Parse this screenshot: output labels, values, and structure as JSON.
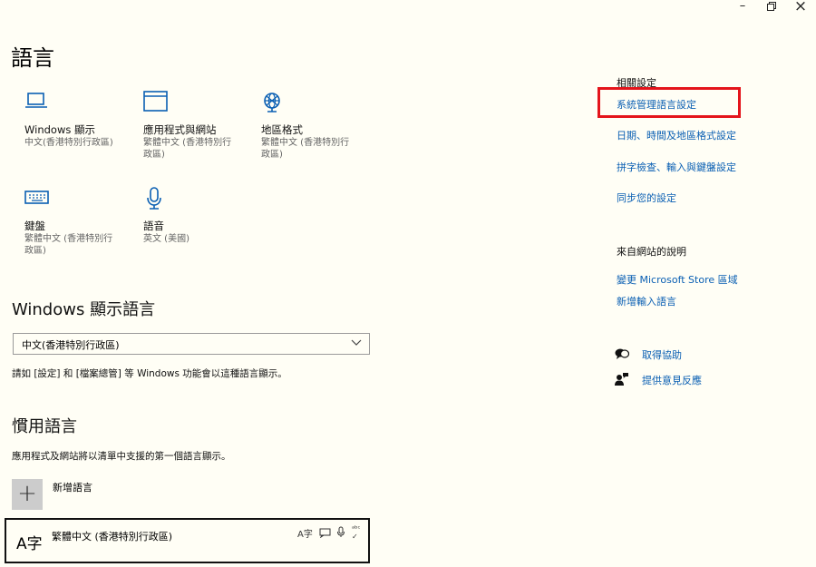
{
  "window": {
    "minimize_glyph": "–",
    "close_glyph": "×"
  },
  "page": {
    "title": "語言"
  },
  "tiles": [
    {
      "icon": "laptop-icon",
      "title": "Windows 顯示",
      "subtitle": "中文(香港特別行政區)"
    },
    {
      "icon": "window-icon",
      "title": "應用程式與網站",
      "subtitle": "繁體中文 (香港特別行\n政區)"
    },
    {
      "icon": "globe-icon",
      "title": "地區格式",
      "subtitle": "繁體中文 (香港特別行\n政區)"
    },
    {
      "icon": "keyboard-icon",
      "title": "鍵盤",
      "subtitle": "繁體中文 (香港特別行\n政區)"
    },
    {
      "icon": "microphone-icon",
      "title": "語音",
      "subtitle": "英文 (美國)"
    }
  ],
  "display_language": {
    "heading": "Windows 顯示語言",
    "selected": "中文(香港特別行政區)",
    "hint": "請如 [設定] 和 [檔案總管] 等 Windows 功能會以這種語言顯示。"
  },
  "preferred_languages": {
    "heading": "慣用語言",
    "hint": "應用程式及網站將以清單中支援的第一個語言顯示。",
    "add_label": "新增語言",
    "add_glyph": "+",
    "items": [
      {
        "name": "繁體中文 (香港特別行政區)",
        "icon_text": "A字"
      }
    ]
  },
  "related": {
    "heading": "相關設定",
    "links": [
      "系統管理語言設定",
      "日期、時間及地區格式設定",
      "拼字檢查、輸入與鍵盤設定",
      "同步您的設定"
    ]
  },
  "web_help": {
    "heading": "來自網站的說明",
    "links": [
      "變更 Microsoft Store 區域",
      "新增輸入語言"
    ]
  },
  "support": {
    "get_help": "取得協助",
    "feedback": "提供意見反應"
  },
  "colors": {
    "accent": "#0a5fb3",
    "highlight": "#e4141b",
    "background": "#fffef5"
  }
}
